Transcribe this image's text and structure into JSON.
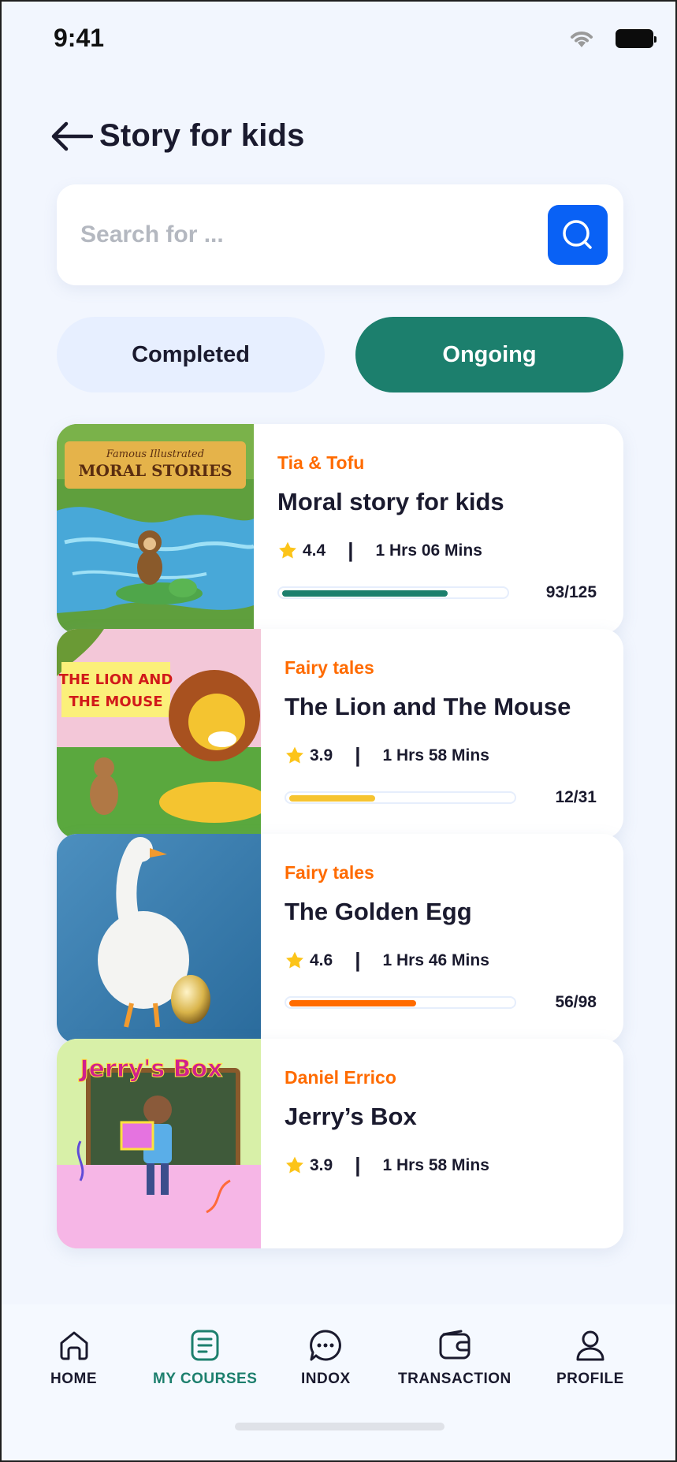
{
  "status_bar": {
    "time": "9:41"
  },
  "header": {
    "title": "Story for kids"
  },
  "search": {
    "placeholder": "Search for ..."
  },
  "tabs": [
    {
      "label": "Completed",
      "active": false
    },
    {
      "label": "Ongoing",
      "active": true
    }
  ],
  "courses": [
    {
      "category": "Tia & Tofu",
      "title": "Moral story for kids",
      "rating": "4.4",
      "duration": "1 Hrs 06 Mins",
      "progress": "93/125",
      "progress_fraction": 0.744,
      "bar_color": "#1c7f6d",
      "thumb_text": "Famous Illustrated MORAL STORIES"
    },
    {
      "category": "Fairy tales",
      "title": "The Lion and The Mouse",
      "rating": "3.9",
      "duration": "1 Hrs 58 Mins",
      "progress": "12/31",
      "progress_fraction": 0.387,
      "bar_color": "#f6c431",
      "thumb_text": "THE LION AND THE MOUSE"
    },
    {
      "category": "Fairy tales",
      "title": "The Golden Egg",
      "rating": "4.6",
      "duration": "1 Hrs 46 Mins",
      "progress": "56/98",
      "progress_fraction": 0.571,
      "bar_color": "#ff6b00"
    },
    {
      "category": "Daniel Errico",
      "title": "Jerry’s Box",
      "rating": "3.9",
      "duration": "1 Hrs 58 Mins",
      "thumb_text": "Jerry's Box"
    }
  ],
  "bottom_nav": [
    {
      "label": "HOME",
      "icon": "home-icon",
      "active": false
    },
    {
      "label": "MY COURSES",
      "icon": "courses-icon",
      "active": true
    },
    {
      "label": "INDOX",
      "icon": "chat-icon",
      "active": false
    },
    {
      "label": "TRANSACTION",
      "icon": "wallet-icon",
      "active": false
    },
    {
      "label": "PROFILE",
      "icon": "profile-icon",
      "active": false
    }
  ],
  "colors": {
    "accent": "#1c7f6d",
    "search_button": "#0961f5",
    "category": "#ff6b00"
  }
}
